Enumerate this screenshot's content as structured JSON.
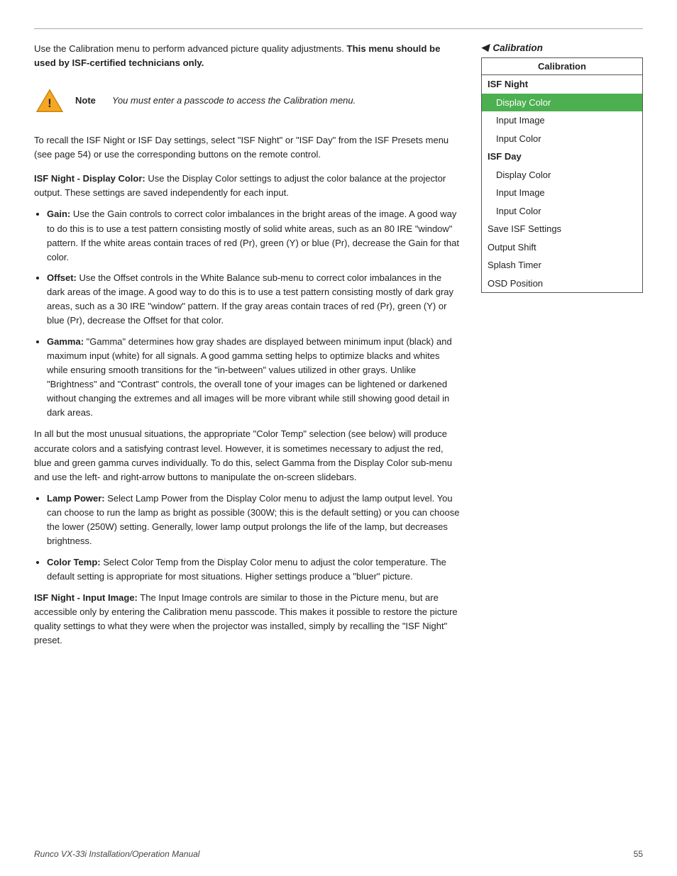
{
  "page": {
    "top_rule": true,
    "intro": {
      "text_before_bold": "Use the Calibration menu to perform advanced picture quality adjustments. ",
      "bold_text": "This menu should be used by ISF-certified technicians only."
    },
    "note": {
      "label": "Note",
      "text": "You must enter a passcode to access the Calibration menu."
    },
    "recall_text": "To recall the ISF Night or ISF Day settings, select \"ISF Night\" or \"ISF Day\" from the ISF Presets menu (see page 54) or use the corresponding buttons on the remote control.",
    "section1_heading": "ISF Night - Display Color:",
    "section1_intro": "Use the Display Color settings to adjust the color balance at the projector output. These settings are saved independently for each input.",
    "bullets": [
      {
        "heading": "Gain:",
        "text": "Use the Gain controls to correct color imbalances in the bright areas of the image. A good way to do this is to use a test pattern consisting mostly of solid white areas, such as an 80 IRE \"window\" pattern. If the white areas contain traces of red (Pr), green (Y) or blue (Pr), decrease the Gain for that color."
      },
      {
        "heading": "Offset:",
        "text": "Use the Offset controls in the White Balance sub-menu to correct color imbalances in the dark areas of the image. A good way to do this is to use a test pattern consisting mostly of dark gray areas, such as a 30 IRE \"window\" pattern. If the gray areas contain traces of red (Pr), green (Y) or blue (Pr), decrease the Offset for that color."
      },
      {
        "heading": "Gamma:",
        "text": "\"Gamma\" determines how gray shades are displayed between minimum input (black) and maximum input (white) for all signals. A good gamma setting helps to optimize blacks and whites while ensuring smooth transitions for the \"in-between\" values utilized in other grays. Unlike \"Brightness\" and \"Contrast\" controls, the overall tone of your images can be lightened or darkened without changing the extremes and all images will be more vibrant while still showing good detail in dark areas."
      }
    ],
    "gamma_extra_para": "In all but the most unusual situations, the appropriate \"Color Temp\" selection (see below) will produce accurate colors and a satisfying contrast level. However, it is sometimes necessary to adjust the red, blue and green gamma curves individually. To do this, select Gamma from the Display Color sub-menu and use the left- and right-arrow buttons to manipulate the on-screen slidebars.",
    "bullets2": [
      {
        "heading": "Lamp Power:",
        "text": "Select Lamp Power from the Display Color menu to adjust the lamp output level. You can choose to run the lamp as bright as possible (300W; this is the default setting) or you can choose the lower (250W) setting. Generally, lower lamp output prolongs the life of the lamp, but decreases brightness."
      },
      {
        "heading": "Color Temp:",
        "text": "Select Color Temp from the Display Color menu to adjust the color temperature. The default setting is appropriate for most situations. Higher settings produce a \"bluer\" picture."
      }
    ],
    "section2_heading": "ISF Night - Input Image:",
    "section2_text": "The Input Image controls are similar to those in the Picture menu, but are accessible only by entering the Calibration menu passcode. This makes it possible to restore the picture quality settings to what they were when the projector was installed, simply by recalling the \"ISF Night\" preset.",
    "sidebar": {
      "calibration_label": "Calibration",
      "menu_title": "Calibration",
      "items": [
        {
          "label": "ISF Night",
          "type": "section-label"
        },
        {
          "label": "Display Color",
          "type": "sub-item-highlighted"
        },
        {
          "label": "Input Image",
          "type": "sub-item"
        },
        {
          "label": "Input Color",
          "type": "sub-item"
        },
        {
          "label": "ISF Day",
          "type": "section-label"
        },
        {
          "label": "Display Color",
          "type": "sub-item"
        },
        {
          "label": "Input Image",
          "type": "sub-item"
        },
        {
          "label": "Input Color",
          "type": "sub-item"
        },
        {
          "label": "Save ISF Settings",
          "type": "top-level-plain"
        },
        {
          "label": "Output Shift",
          "type": "top-level-plain"
        },
        {
          "label": "Splash Timer",
          "type": "top-level-plain"
        },
        {
          "label": "OSD Position",
          "type": "top-level-plain"
        }
      ]
    },
    "footer": {
      "left": "Runco VX-33i Installation/Operation Manual",
      "center": "55"
    }
  }
}
